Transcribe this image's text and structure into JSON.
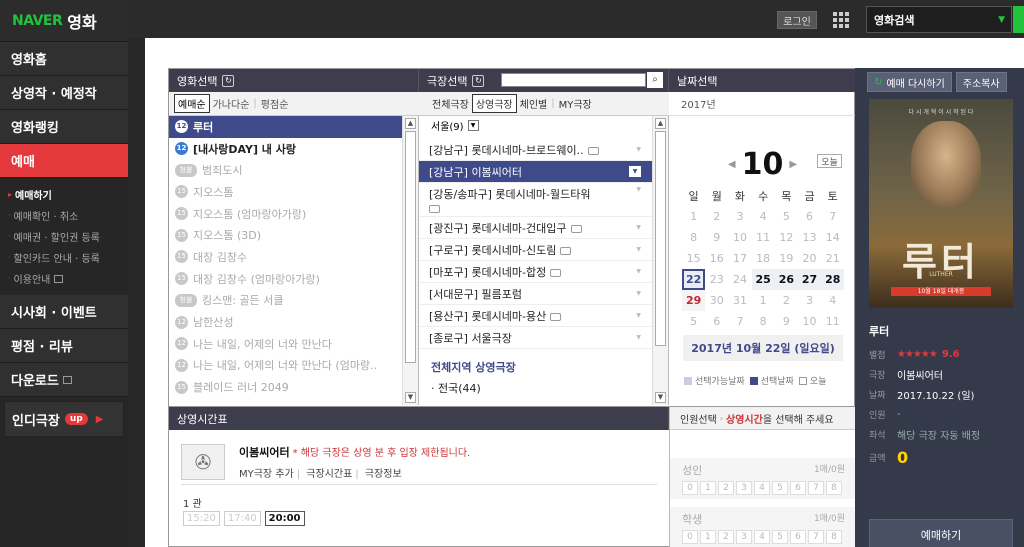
{
  "topbar": {
    "login": "로그인",
    "search_label": "영화검색"
  },
  "sidebar": {
    "logo": {
      "naver": "NAVER",
      "title": "영화"
    },
    "home": "영화홈",
    "showing": "상영작 · 예정작",
    "ranking": "영화랭킹",
    "booking": "예매",
    "booking_sub": [
      "예매하기",
      "예매확인 · 취소",
      "예매권 · 할인권 등록",
      "할인카드 안내 · 등록",
      "이용안내"
    ],
    "events": "시사회 · 이벤트",
    "reviews": "평점 · 리뷰",
    "download": "다운로드",
    "indie": "인디극장",
    "indie_badge": "up"
  },
  "movie_panel": {
    "header": "영화선택",
    "sort": [
      "예매순",
      "가나다순",
      "평점순"
    ],
    "movies": [
      {
        "age": "12",
        "title": "루터"
      },
      {
        "age": "12",
        "title": "[내사랑DAY] 내 사랑"
      },
      {
        "age": "청불",
        "title": "범죄도시"
      },
      {
        "age": "15",
        "title": "지오스톰"
      },
      {
        "age": "15",
        "title": "지오스톰 (엄마랑아가랑)"
      },
      {
        "age": "15",
        "title": "지오스톰 (3D)"
      },
      {
        "age": "15",
        "title": "대장 김창수"
      },
      {
        "age": "15",
        "title": "대장 김창수 (엄마랑아가랑)"
      },
      {
        "age": "청불",
        "title": "킹스맨: 골든 서클"
      },
      {
        "age": "12",
        "title": "남한산성"
      },
      {
        "age": "12",
        "title": "나는 내일, 어제의 너와 만난다"
      },
      {
        "age": "12",
        "title": "나는 내일, 어제의 너와 만난다 (엄마랑.."
      },
      {
        "age": "15",
        "title": "블레이드 러너 2049"
      }
    ]
  },
  "theater_panel": {
    "header": "극장선택",
    "tabs": [
      "전체극장",
      "상영극장",
      "체인별",
      "MY극장"
    ],
    "region": "서울(9)",
    "theaters": [
      "[강남구] 롯데시네마-브로드웨이..",
      "[강남구] 이봄씨어터",
      "[강동/송파구] 롯데시네마-월드타워",
      "[광진구] 롯데시네마-건대입구",
      "[구로구] 롯데시네마-신도림",
      "[마포구] 롯데시네마-합정",
      "[서대문구] 필름포럼",
      "[용산구] 롯데시네마-용산",
      "[종로구] 서울극장"
    ],
    "all_regions_title": "전체지역 상영극장",
    "all_regions_item": "· 전국(44)"
  },
  "date_panel": {
    "header": "날짜선택",
    "year": "2017년",
    "month": "10",
    "today": "오늘",
    "weekdays": [
      "일",
      "월",
      "화",
      "수",
      "목",
      "금",
      "토"
    ],
    "weeks": [
      [
        "1",
        "2",
        "3",
        "4",
        "5",
        "6",
        "7"
      ],
      [
        "8",
        "9",
        "10",
        "11",
        "12",
        "13",
        "14"
      ],
      [
        "15",
        "16",
        "17",
        "18",
        "19",
        "20",
        "21"
      ],
      [
        "22",
        "23",
        "24",
        "25",
        "26",
        "27",
        "28"
      ],
      [
        "29",
        "30",
        "31",
        "1",
        "2",
        "3",
        "4"
      ],
      [
        "5",
        "6",
        "7",
        "8",
        "9",
        "10",
        "11"
      ]
    ],
    "full_date": "2017년 10월 22일 (일요일)",
    "legend": [
      "선택가능날짜",
      "선택날짜",
      "오늘"
    ]
  },
  "showtime_panel": {
    "header": "상영시간표",
    "theater": "이봄씨어터",
    "notice": "* 해당 극장은 상영 분 후 입장 제한됩니다.",
    "links": [
      "MY극장 추가",
      "극장시간표",
      "극장정보"
    ],
    "hall": "1 관",
    "times": [
      "15:20",
      "17:40",
      "20:00"
    ]
  },
  "people_panel": {
    "header_a": "인원선택",
    "header_b": "상영시간",
    "header_c": "을 선택해 주세요",
    "groups": [
      {
        "label": "성인",
        "limit": "1매/0원"
      },
      {
        "label": "학생",
        "limit": "1매/0원"
      }
    ],
    "numbers": [
      "0",
      "1",
      "2",
      "3",
      "4",
      "5",
      "6",
      "7",
      "8"
    ]
  },
  "right_panel": {
    "rebook": "예매 다시하기",
    "copy_address": "주소복사",
    "poster_title": "루터",
    "poster_tag": "다 시 개 혁 이 시 작 된 다",
    "poster_sub": "LUTHER",
    "poster_date": "10월 18일 대개봉",
    "title": "루터",
    "labels": {
      "rating": "별점",
      "theater": "극장",
      "date": "날짜",
      "people": "인원",
      "seat": "좌석",
      "amount": "금액"
    },
    "stars": "★★★★★",
    "score": "9.6",
    "theater": "이봄씨어터",
    "date": "2017.10.22 (일)",
    "people": "-",
    "seat": "해당 극장 자동 배정",
    "amount": "0",
    "book_button": "예매하기"
  },
  "colors": {
    "accent_red": "#e3383c",
    "brand_green": "#22c33c",
    "selected_blue": "#3f4a8b",
    "panel_dark": "#3d3d4d"
  }
}
